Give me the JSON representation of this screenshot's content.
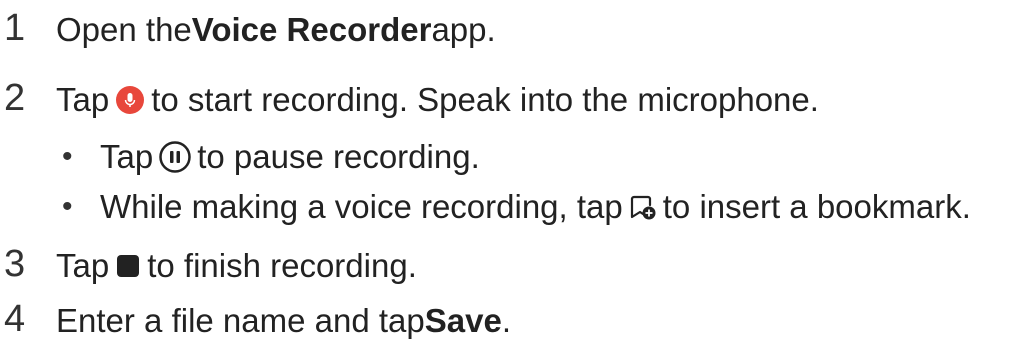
{
  "steps": [
    {
      "number": "1",
      "before": "Open the ",
      "bold": "Voice Recorder",
      "after": " app."
    },
    {
      "number": "2",
      "before": "Tap",
      "after": "to start recording. Speak into the microphone.",
      "icon": "record-mic-icon",
      "bullets": [
        {
          "before": "Tap",
          "after": "to pause recording.",
          "icon": "pause-icon"
        },
        {
          "before": "While making a voice recording, tap",
          "after": "to insert a bookmark.",
          "icon": "add-bookmark-icon"
        }
      ]
    },
    {
      "number": "3",
      "before": "Tap",
      "after": "to finish recording.",
      "icon": "stop-icon"
    },
    {
      "number": "4",
      "before": "Enter a file name and tap ",
      "bold": "Save",
      "after": "."
    }
  ],
  "colors": {
    "record_red": "#e8473b",
    "text": "#222222",
    "stop_fill": "#222222"
  }
}
